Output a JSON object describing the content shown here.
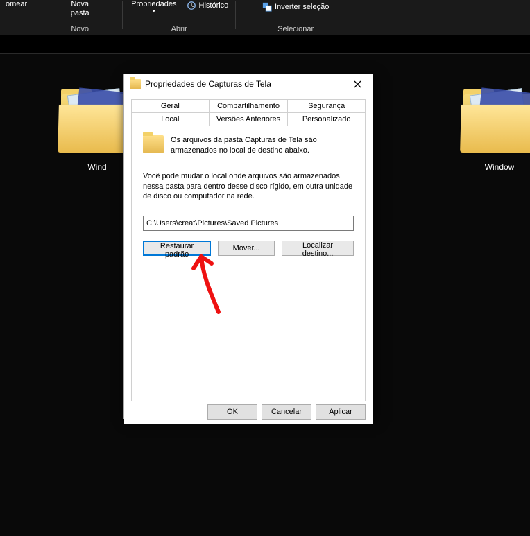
{
  "ribbon": {
    "rename_label": "omear",
    "new_folder_label": "Nova\npasta",
    "group_new": "Novo",
    "properties_label": "Propriedades",
    "history_label": "Histórico",
    "group_open": "Abrir",
    "invert_selection_label": "Inverter seleção",
    "group_select": "Selecionar"
  },
  "files": {
    "left_label": "Wind",
    "right_label": "Window"
  },
  "dialog": {
    "title": "Propriedades de Capturas de Tela",
    "tabs": {
      "geral": "Geral",
      "compart": "Compartilhamento",
      "seguranca": "Segurança",
      "local": "Local",
      "versoes": "Versões Anteriores",
      "personalizado": "Personalizado"
    },
    "desc1": "Os arquivos da pasta Capturas de Tela são armazenados no local de destino abaixo.",
    "desc2": "Você pode mudar o local onde arquivos são armazenados nessa pasta para dentro desse disco rígido, em outra unidade de disco ou computador na rede.",
    "path": "C:\\Users\\creat\\Pictures\\Saved Pictures",
    "restore_btn": "Restaurar padrão",
    "move_btn": "Mover...",
    "find_btn": "Localizar destino...",
    "ok": "OK",
    "cancel": "Cancelar",
    "apply": "Aplicar"
  }
}
